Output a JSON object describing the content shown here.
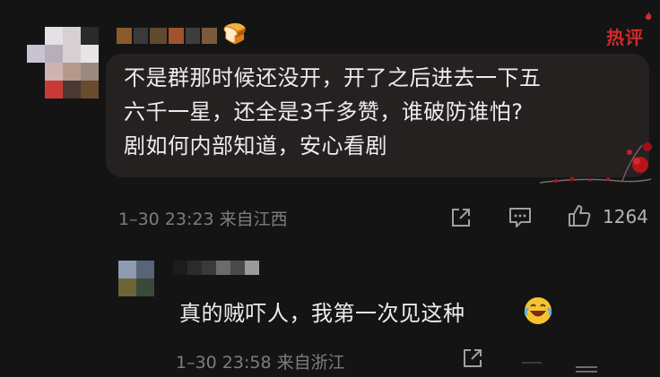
{
  "comment": {
    "badge": "热评",
    "lines": [
      "不是群那时候还没开，开了之后进去一下五",
      "六千一星，还全是3千多赞，谁破防谁怕?",
      "剧如何内部知道，安心看剧"
    ],
    "meta": "1–30 23:23 来自江西",
    "likes": "1264",
    "user_emoji": "🍞"
  },
  "reply": {
    "text": "真的贼吓人，我第一次见这种",
    "emoji": "laughing-crying-emoji",
    "meta": "1–30 23:58 来自浙江"
  },
  "colors": {
    "background": "#141414",
    "bubble": "#262121",
    "hot_badge": "#d02b2b",
    "meta_text": "#7d7d7d"
  },
  "icons": [
    "share-icon",
    "comment-icon",
    "thumbs-up-icon"
  ]
}
